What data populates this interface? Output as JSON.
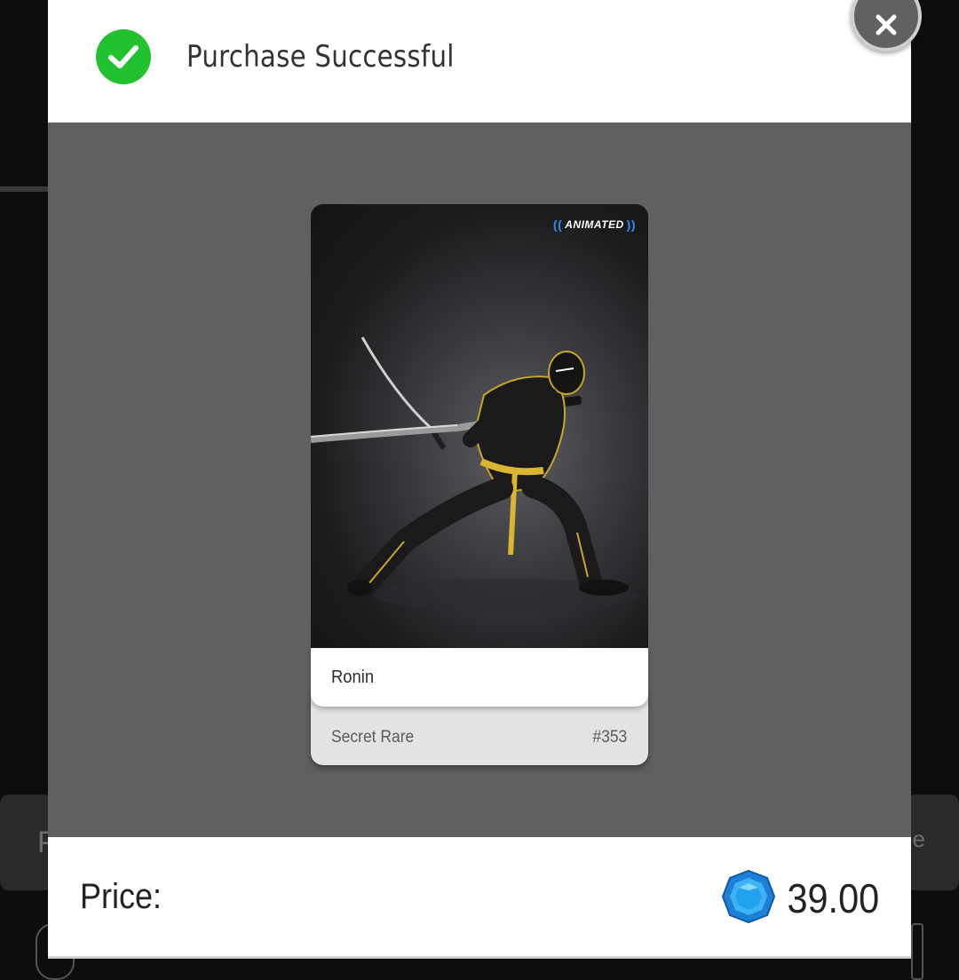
{
  "modal": {
    "title": "Purchase Successful",
    "close_icon": "close-icon",
    "success_icon": "check-circle-icon"
  },
  "card": {
    "badge": "ANIMATED",
    "name": "Ronin",
    "rarity": "Secret Rare",
    "serial": "#353"
  },
  "footer": {
    "price_label": "Price:",
    "price_value": "39.00",
    "currency_icon": "gem-icon"
  },
  "background": {
    "left_fragment": "P",
    "right_fragment": "e"
  },
  "colors": {
    "success": "#21c12f",
    "accent_blue": "#2f8ff2",
    "overlay": "#606060"
  }
}
